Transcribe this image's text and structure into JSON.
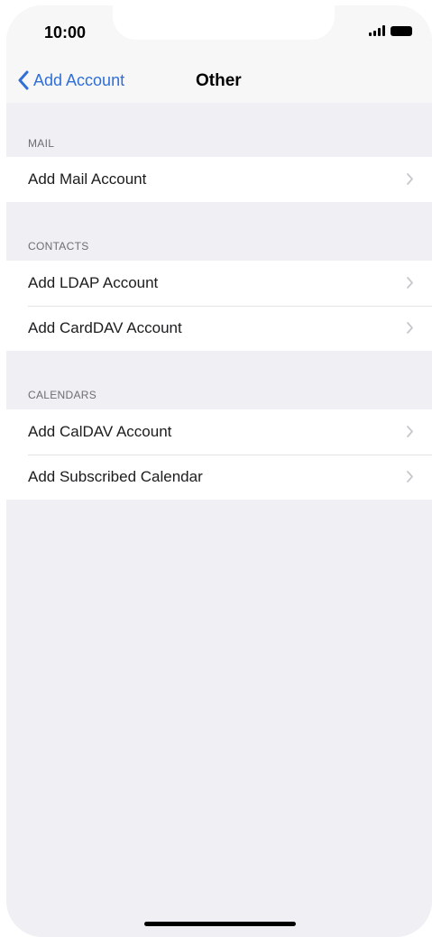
{
  "status_bar": {
    "time": "10:00"
  },
  "nav": {
    "back_label": "Add Account",
    "title": "Other"
  },
  "sections": [
    {
      "header": "MAIL",
      "items": [
        {
          "label": "Add Mail Account"
        }
      ]
    },
    {
      "header": "CONTACTS",
      "items": [
        {
          "label": "Add LDAP Account"
        },
        {
          "label": "Add CardDAV Account"
        }
      ]
    },
    {
      "header": "CALENDARS",
      "items": [
        {
          "label": "Add CalDAV Account"
        },
        {
          "label": "Add Subscribed Calendar"
        }
      ]
    }
  ],
  "colors": {
    "accent": "#2f6fd6",
    "background": "#efeff4",
    "section_header": "#6d6d72"
  },
  "icons": {
    "back": "chevron-left-icon",
    "row": "chevron-right-icon"
  }
}
